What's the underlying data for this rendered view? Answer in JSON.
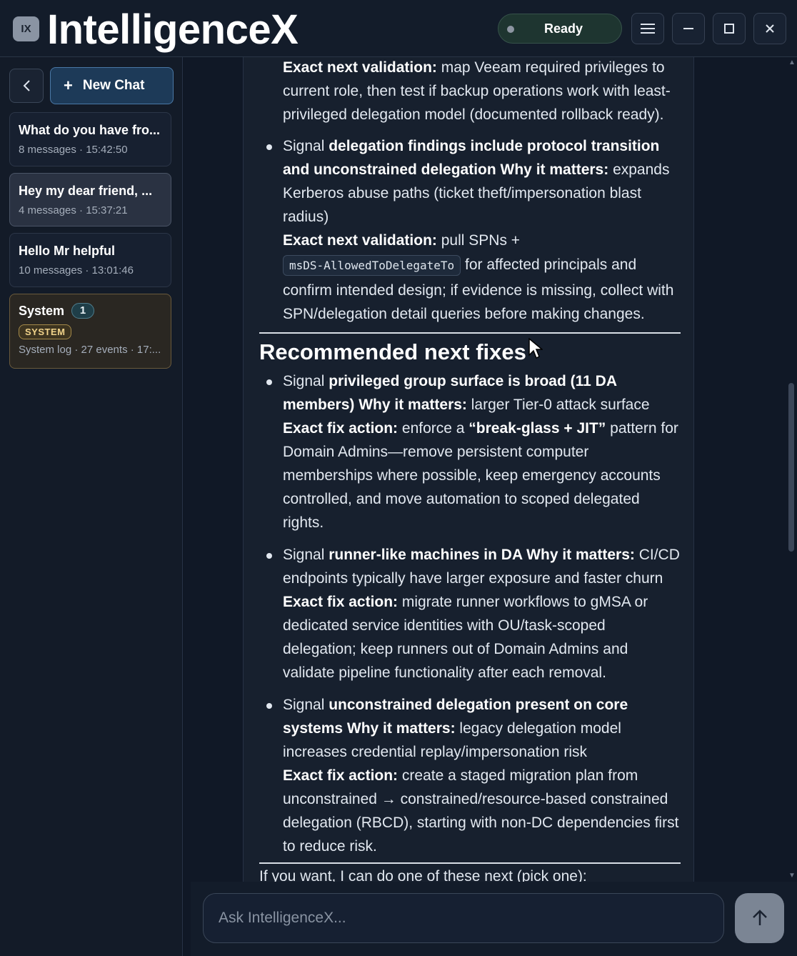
{
  "app": {
    "logo_text": "IX",
    "title": "IntelligenceX",
    "status": "Ready"
  },
  "window_controls": {
    "menu_icon": "hamburger-icon",
    "minimize_icon": "minimize-icon",
    "maximize_icon": "maximize-icon",
    "close_icon": "close-icon"
  },
  "sidebar": {
    "new_chat_label": "New Chat",
    "chats": [
      {
        "title": "What do you have fro...",
        "meta": "8 messages · 15:42:50"
      },
      {
        "title": "Hey my dear friend, ...",
        "meta": "4 messages · 15:37:21"
      },
      {
        "title": "Hello Mr helpful",
        "meta": "10 messages · 13:01:46"
      }
    ],
    "system": {
      "title": "System",
      "count": "1",
      "tag": "SYSTEM",
      "meta": "System log · 27 events · 17:..."
    }
  },
  "message": {
    "top_validation_label": "Exact next validation:",
    "top_validation_text": " map Veeam required privileges to current role, then test if backup operations work with least-privileged delegation model (documented rollback ready).",
    "bullet1": {
      "signal": "Signal ",
      "signal_bold": "delegation findings include protocol transition and unconstrained delegation",
      "why_label": " Why it matters:",
      "why_text": " expands Kerberos abuse paths (ticket theft/impersonation blast radius)",
      "validation_label": "Exact next validation:",
      "validation_text_1": " pull SPNs + ",
      "code": "msDS-AllowedToDelegateTo",
      "validation_text_2": " for affected principals and confirm intended design; if evidence is missing, collect with SPN/delegation detail queries before making changes."
    },
    "heading": "Recommended next fixes",
    "fixes": [
      {
        "signal": "Signal ",
        "signal_bold": "privileged group surface is broad (11 DA members)",
        "why_label": " Why it matters:",
        "why_text": " larger Tier-0 attack surface",
        "fix_label": "Exact fix action:",
        "fix_text_1": " enforce a ",
        "fix_bold": "“break-glass + JIT”",
        "fix_text_2": " pattern for Domain Admins—remove persistent computer memberships where possible, keep emergency accounts controlled, and move automation to scoped delegated rights."
      },
      {
        "signal": "Signal ",
        "signal_bold": "runner-like machines in DA",
        "why_label": " Why it matters:",
        "why_text": " CI/CD endpoints typically have larger exposure and faster churn",
        "fix_label": "Exact fix action:",
        "fix_text_1": " migrate runner workflows to gMSA or dedicated service identities with OU/task-scoped delegation; keep runners out of Domain Admins and validate pipeline functionality after each removal.",
        "fix_bold": "",
        "fix_text_2": ""
      },
      {
        "signal": "Signal ",
        "signal_bold": "unconstrained delegation present on core systems",
        "why_label": " Why it matters:",
        "why_text": " legacy delegation model increases credential replay/impersonation risk",
        "fix_label": "Exact fix action:",
        "fix_text_1": " create a staged migration plan from unconstrained → constrained/resource-based constrained delegation (RBCD), starting with non-DC dependencies first to reduce risk.",
        "fix_bold": "",
        "fix_text_2": ""
      }
    ],
    "closing": "If you want, I can do one of these next (pick one):"
  },
  "composer": {
    "placeholder": "Ask IntelligenceX..."
  }
}
